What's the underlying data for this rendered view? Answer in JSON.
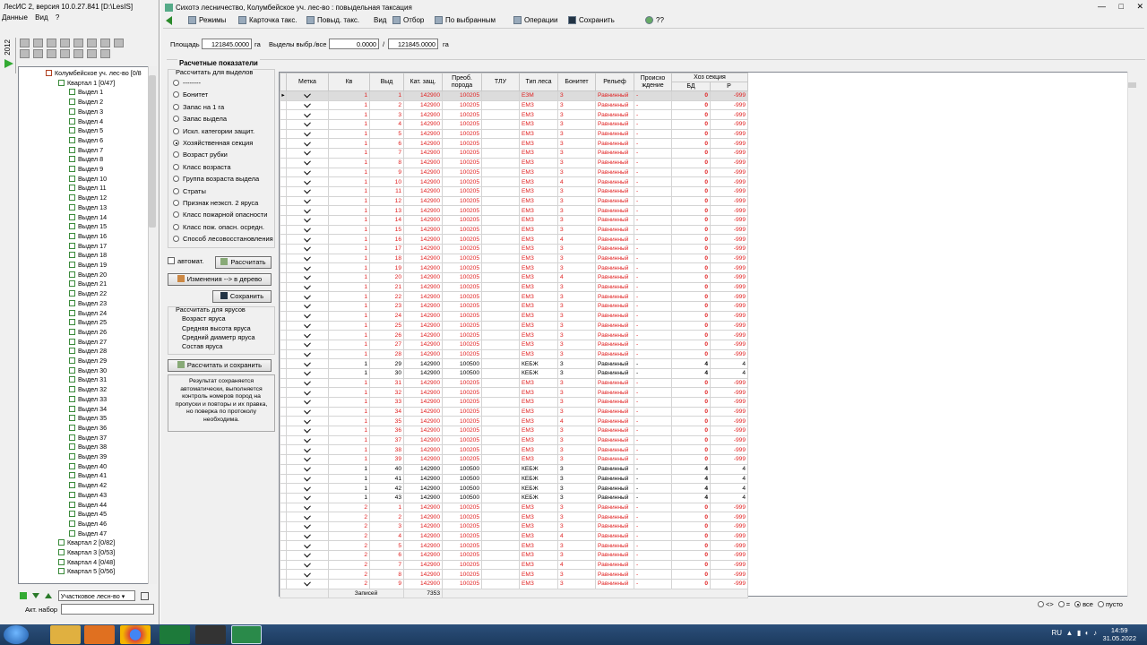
{
  "left_window": {
    "title": "ЛесИС 2, версия 10.0.27.841 [D:\\LesIS]",
    "menu": [
      "Данные",
      "Вид",
      "?"
    ],
    "year": "2012",
    "tree_root": "Колумбейское уч. лес-во [0/8",
    "tree_kv1": "Квартал 1 [0/47]",
    "vydel_prefix": "Выдел",
    "vydel_count": 47,
    "tree_kv_tail": [
      "Квартал 2 [0/82]",
      "Квартал 3 [0/53]",
      "Квартал 4 [0/48]",
      "Квартал 5 [0/56]"
    ],
    "combo_value": "Участковое лесн-во",
    "akt_label": "Акт. набор"
  },
  "main_window": {
    "title": "Сихотэ лесничество, Колумбейское уч. лес-во : повыдельная таксация",
    "window_buttons": [
      "—",
      "□",
      "✕"
    ],
    "toolbar": {
      "modes": "Режимы",
      "card": "Карточка такс.",
      "povyd": "Повыд. такс.",
      "view": "Вид",
      "select": "Отбор",
      "by_selected": "По выбранным",
      "operations": "Операции",
      "save": "Сохранить",
      "help": "??"
    },
    "filter": {
      "area_label": "Площадь",
      "area_value": "121845.0000",
      "area_unit": "га",
      "sel_label": "Выделы выбр./все",
      "sel_value": "0.0000",
      "sep": "/",
      "all_value": "121845.0000",
      "all_unit": "га"
    },
    "section_title": "Расчетные показатели",
    "group_label": "Рассчитать для выделов",
    "radios": [
      "--------",
      "Бонитет",
      "Запас на 1 га",
      "Запас выдела",
      "Искл. категории защит.",
      "Хозяйственная секция",
      "Возраст рубки",
      "Класс возраста",
      "Группа возраста выдела",
      "Страты",
      "Признак неэксп. 2 яруса",
      "Класс пожарной опасности",
      "Класс пож. опасн. осредн.",
      "Способ лесовосстановления"
    ],
    "radio_selected_index": 5,
    "auto_label": "автомат.",
    "calc_button": "Рассчитать",
    "changes_button": "Изменения --> в дерево",
    "save_button": "Сохранить",
    "yarus_title": "Рассчитать для ярусов",
    "yarus_items": [
      "Возраст яруса",
      "Средняя высота яруса",
      "Средний диаметр яруса",
      "Состав яруса"
    ],
    "calc_save_button": "Рассчитать и сохранить",
    "note": "Результат сохраняется автоматически, выполняется контроль номеров пород на пропуски и повторы и их правка, но поверка по протоколу необходима.",
    "grid": {
      "columns": [
        "Метка",
        "Кв",
        "Выд",
        "Кат. защ.",
        "Преоб. порода",
        "ТЛУ",
        "Тип леса",
        "Бонитет",
        "Рельеф",
        "Происхо ждение",
        "Хоз секция"
      ],
      "sub_columns": [
        "БД",
        "Р"
      ],
      "rows": [
        [
          "1",
          "1",
          "142900",
          "100205",
          "",
          "ЕЗМ",
          "3",
          "Равнинный",
          "-",
          "0",
          "-999",
          "r"
        ],
        [
          "1",
          "2",
          "142900",
          "100205",
          "",
          "ЕМЗ",
          "3",
          "Равнинный",
          "-",
          "0",
          "-999",
          "r"
        ],
        [
          "1",
          "3",
          "142900",
          "100205",
          "",
          "ЕМЗ",
          "3",
          "Равнинный",
          "-",
          "0",
          "-999",
          "r"
        ],
        [
          "1",
          "4",
          "142900",
          "100205",
          "",
          "ЕМЗ",
          "3",
          "Равнинный",
          "-",
          "0",
          "-999",
          "r"
        ],
        [
          "1",
          "5",
          "142900",
          "100205",
          "",
          "ЕМЗ",
          "3",
          "Равнинный",
          "-",
          "0",
          "-999",
          "r"
        ],
        [
          "1",
          "6",
          "142900",
          "100205",
          "",
          "ЕМЗ",
          "3",
          "Равнинный",
          "-",
          "0",
          "-999",
          "r"
        ],
        [
          "1",
          "7",
          "142900",
          "100205",
          "",
          "ЕМЗ",
          "3",
          "Равнинный",
          "-",
          "0",
          "-999",
          "r"
        ],
        [
          "1",
          "8",
          "142900",
          "100205",
          "",
          "ЕМЗ",
          "3",
          "Равнинный",
          "-",
          "0",
          "-999",
          "r"
        ],
        [
          "1",
          "9",
          "142900",
          "100205",
          "",
          "ЕМЗ",
          "3",
          "Равнинный",
          "-",
          "0",
          "-999",
          "r"
        ],
        [
          "1",
          "10",
          "142900",
          "100205",
          "",
          "ЕМЗ",
          "4",
          "Равнинный",
          "-",
          "0",
          "-999",
          "r"
        ],
        [
          "1",
          "11",
          "142900",
          "100205",
          "",
          "ЕМЗ",
          "3",
          "Равнинный",
          "-",
          "0",
          "-999",
          "r"
        ],
        [
          "1",
          "12",
          "142900",
          "100205",
          "",
          "ЕМЗ",
          "3",
          "Равнинный",
          "-",
          "0",
          "-999",
          "r"
        ],
        [
          "1",
          "13",
          "142900",
          "100205",
          "",
          "ЕМЗ",
          "3",
          "Равнинный",
          "-",
          "0",
          "-999",
          "r"
        ],
        [
          "1",
          "14",
          "142900",
          "100205",
          "",
          "ЕМЗ",
          "3",
          "Равнинный",
          "-",
          "0",
          "-999",
          "r"
        ],
        [
          "1",
          "15",
          "142900",
          "100205",
          "",
          "ЕМЗ",
          "3",
          "Равнинный",
          "-",
          "0",
          "-999",
          "r"
        ],
        [
          "1",
          "16",
          "142900",
          "100205",
          "",
          "ЕМЗ",
          "4",
          "Равнинный",
          "-",
          "0",
          "-999",
          "r"
        ],
        [
          "1",
          "17",
          "142900",
          "100205",
          "",
          "ЕМЗ",
          "3",
          "Равнинный",
          "-",
          "0",
          "-999",
          "r"
        ],
        [
          "1",
          "18",
          "142900",
          "100205",
          "",
          "ЕМЗ",
          "3",
          "Равнинный",
          "-",
          "0",
          "-999",
          "r"
        ],
        [
          "1",
          "19",
          "142900",
          "100205",
          "",
          "ЕМЗ",
          "3",
          "Равнинный",
          "-",
          "0",
          "-999",
          "r"
        ],
        [
          "1",
          "20",
          "142900",
          "100205",
          "",
          "ЕМЗ",
          "4",
          "Равнинный",
          "-",
          "0",
          "-999",
          "r"
        ],
        [
          "1",
          "21",
          "142900",
          "100205",
          "",
          "ЕМЗ",
          "3",
          "Равнинный",
          "-",
          "0",
          "-999",
          "r"
        ],
        [
          "1",
          "22",
          "142900",
          "100205",
          "",
          "ЕМЗ",
          "3",
          "Равнинный",
          "-",
          "0",
          "-999",
          "r"
        ],
        [
          "1",
          "23",
          "142900",
          "100205",
          "",
          "ЕМЗ",
          "3",
          "Равнинный",
          "-",
          "0",
          "-999",
          "r"
        ],
        [
          "1",
          "24",
          "142900",
          "100205",
          "",
          "ЕМЗ",
          "3",
          "Равнинный",
          "-",
          "0",
          "-999",
          "r"
        ],
        [
          "1",
          "25",
          "142900",
          "100205",
          "",
          "ЕМЗ",
          "3",
          "Равнинный",
          "-",
          "0",
          "-999",
          "r"
        ],
        [
          "1",
          "26",
          "142900",
          "100205",
          "",
          "ЕМЗ",
          "3",
          "Равнинный",
          "-",
          "0",
          "-999",
          "r"
        ],
        [
          "1",
          "27",
          "142900",
          "100205",
          "",
          "ЕМЗ",
          "3",
          "Равнинный",
          "-",
          "0",
          "-999",
          "r"
        ],
        [
          "1",
          "28",
          "142900",
          "100205",
          "",
          "ЕМЗ",
          "3",
          "Равнинный",
          "-",
          "0",
          "-999",
          "r"
        ],
        [
          "1",
          "29",
          "142900",
          "100500",
          "",
          "КЕБЖ",
          "3",
          "Равнинный",
          "-",
          "4",
          "4",
          "b"
        ],
        [
          "1",
          "30",
          "142900",
          "100500",
          "",
          "КЕБЖ",
          "3",
          "Равнинный",
          "-",
          "4",
          "4",
          "b"
        ],
        [
          "1",
          "31",
          "142900",
          "100205",
          "",
          "ЕМЗ",
          "3",
          "Равнинный",
          "-",
          "0",
          "-999",
          "r"
        ],
        [
          "1",
          "32",
          "142900",
          "100205",
          "",
          "ЕМЗ",
          "3",
          "Равнинный",
          "-",
          "0",
          "-999",
          "r"
        ],
        [
          "1",
          "33",
          "142900",
          "100205",
          "",
          "ЕМЗ",
          "3",
          "Равнинный",
          "-",
          "0",
          "-999",
          "r"
        ],
        [
          "1",
          "34",
          "142900",
          "100205",
          "",
          "ЕМЗ",
          "3",
          "Равнинный",
          "-",
          "0",
          "-999",
          "r"
        ],
        [
          "1",
          "35",
          "142900",
          "100205",
          "",
          "ЕМЗ",
          "4",
          "Равнинный",
          "-",
          "0",
          "-999",
          "r"
        ],
        [
          "1",
          "36",
          "142900",
          "100205",
          "",
          "ЕМЗ",
          "3",
          "Равнинный",
          "-",
          "0",
          "-999",
          "r"
        ],
        [
          "1",
          "37",
          "142900",
          "100205",
          "",
          "ЕМЗ",
          "3",
          "Равнинный",
          "-",
          "0",
          "-999",
          "r"
        ],
        [
          "1",
          "38",
          "142900",
          "100205",
          "",
          "ЕМЗ",
          "3",
          "Равнинный",
          "-",
          "0",
          "-999",
          "r"
        ],
        [
          "1",
          "39",
          "142900",
          "100205",
          "",
          "ЕМЗ",
          "3",
          "Равнинный",
          "-",
          "0",
          "-999",
          "r"
        ],
        [
          "1",
          "40",
          "142900",
          "100500",
          "",
          "КЕБЖ",
          "3",
          "Равнинный",
          "-",
          "4",
          "4",
          "b"
        ],
        [
          "1",
          "41",
          "142900",
          "100500",
          "",
          "КЕБЖ",
          "3",
          "Равнинный",
          "-",
          "4",
          "4",
          "b"
        ],
        [
          "1",
          "42",
          "142900",
          "100500",
          "",
          "КЕБЖ",
          "3",
          "Равнинный",
          "-",
          "4",
          "4",
          "b"
        ],
        [
          "1",
          "43",
          "142900",
          "100500",
          "",
          "КЕБЖ",
          "3",
          "Равнинный",
          "-",
          "4",
          "4",
          "b"
        ],
        [
          "2",
          "1",
          "142900",
          "100205",
          "",
          "ЕМЗ",
          "3",
          "Равнинный",
          "-",
          "0",
          "-999",
          "r"
        ],
        [
          "2",
          "2",
          "142900",
          "100205",
          "",
          "ЕМЗ",
          "3",
          "Равнинный",
          "-",
          "0",
          "-999",
          "r"
        ],
        [
          "2",
          "3",
          "142900",
          "100205",
          "",
          "ЕМЗ",
          "3",
          "Равнинный",
          "-",
          "0",
          "-999",
          "r"
        ],
        [
          "2",
          "4",
          "142900",
          "100205",
          "",
          "ЕМЗ",
          "4",
          "Равнинный",
          "-",
          "0",
          "-999",
          "r"
        ],
        [
          "2",
          "5",
          "142900",
          "100205",
          "",
          "ЕМЗ",
          "3",
          "Равнинный",
          "-",
          "0",
          "-999",
          "r"
        ],
        [
          "2",
          "6",
          "142900",
          "100205",
          "",
          "ЕМЗ",
          "3",
          "Равнинный",
          "-",
          "0",
          "-999",
          "r"
        ],
        [
          "2",
          "7",
          "142900",
          "100205",
          "",
          "ЕМЗ",
          "4",
          "Равнинный",
          "-",
          "0",
          "-999",
          "r"
        ],
        [
          "2",
          "8",
          "142900",
          "100205",
          "",
          "ЕМЗ",
          "3",
          "Равнинный",
          "-",
          "0",
          "-999",
          "r"
        ],
        [
          "2",
          "9",
          "142900",
          "100205",
          "",
          "ЕМЗ",
          "3",
          "Равнинный",
          "-",
          "0",
          "-999",
          "r"
        ]
      ],
      "records_label": "Записей",
      "records_value": "7353"
    },
    "bottom_filter": [
      "<>",
      "=",
      "все",
      "пусто"
    ],
    "bottom_filter_selected": 2
  },
  "taskbar": {
    "lang": "RU",
    "time": "14:59",
    "date": "31.05.2022"
  }
}
